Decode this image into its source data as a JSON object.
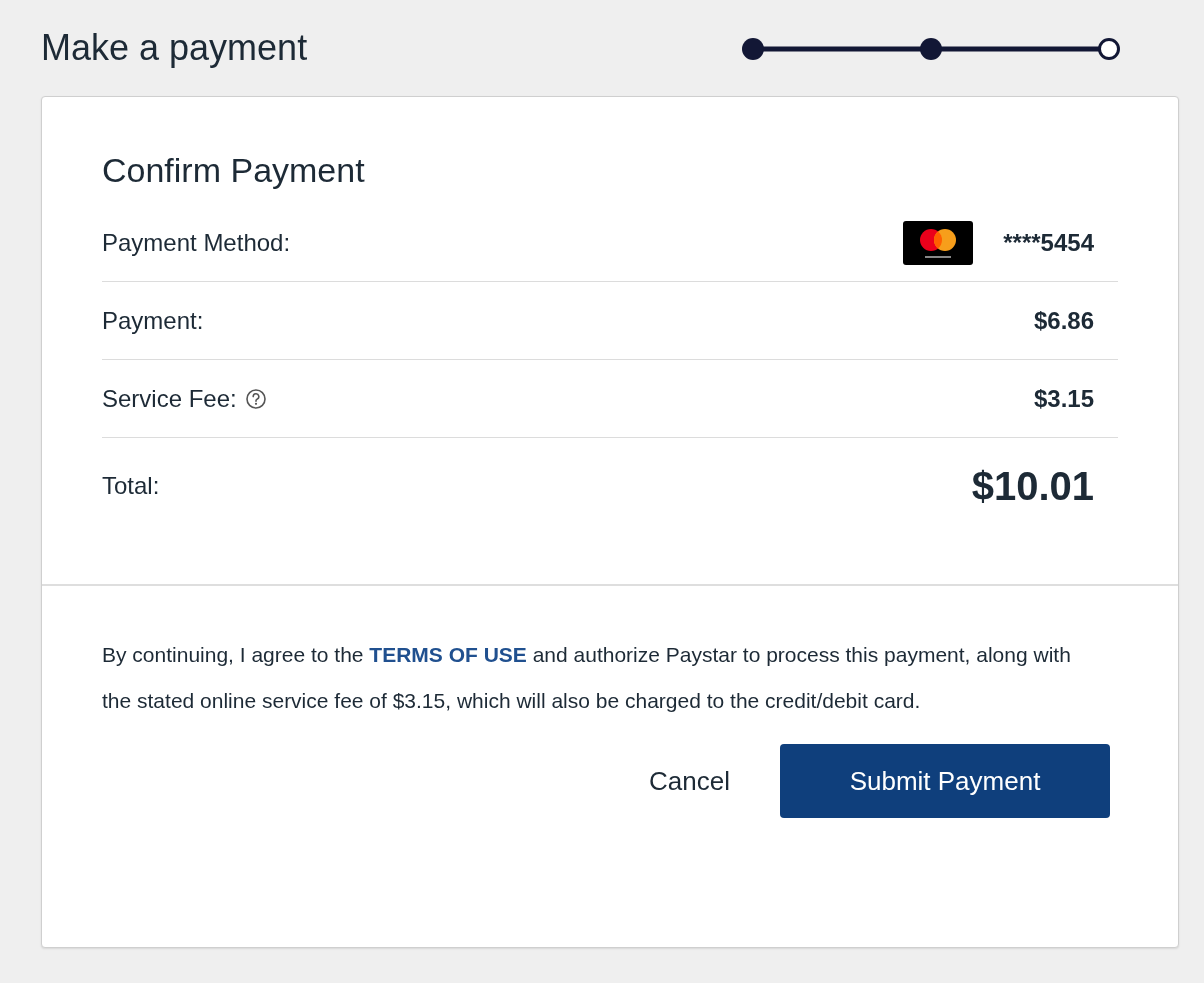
{
  "page_title": "Make a payment",
  "steps": [
    {
      "done": true
    },
    {
      "done": true
    },
    {
      "done": false
    }
  ],
  "card": {
    "title": "Confirm Payment",
    "rows": [
      {
        "kind": "method",
        "label": "Payment Method:",
        "value": "****5454"
      },
      {
        "kind": "row",
        "label": "Payment:",
        "value": "$6.86"
      },
      {
        "kind": "row",
        "label": "Service Fee:",
        "value": "$3.15",
        "info": true
      },
      {
        "kind": "total",
        "label": "Total:",
        "value": "$10.01"
      }
    ],
    "consent": {
      "before": "By continuing, I agree to the ",
      "link": "TERMS OF USE",
      "after": " and authorize Paystar to process this payment, along with the stated online service fee of $3.15, which will also be charged to the credit/debit card."
    },
    "buttons": [
      {
        "kind": "secondary",
        "label": "Cancel"
      },
      {
        "kind": "primary",
        "label": "Submit Payment"
      }
    ]
  }
}
